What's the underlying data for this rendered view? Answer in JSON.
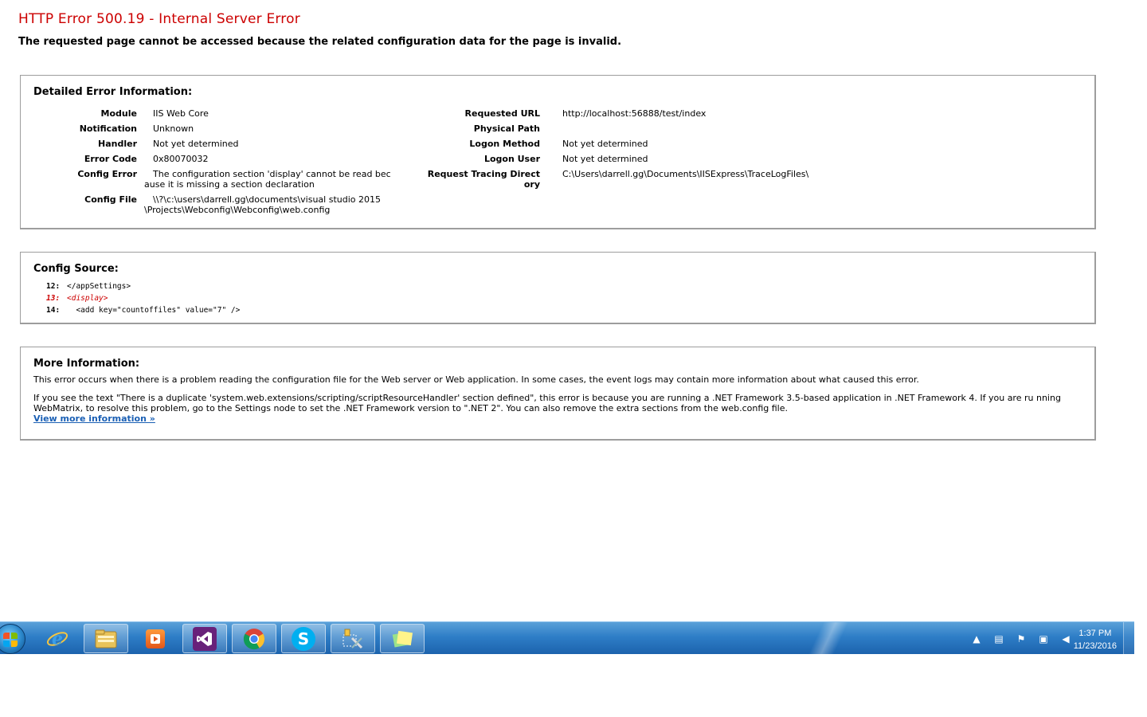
{
  "error": {
    "title": "HTTP Error 500.19 - Internal Server Error",
    "subtitle": "The requested page cannot be accessed because the related configuration data for the page is invalid."
  },
  "details": {
    "heading": "Detailed Error Information:",
    "left": [
      {
        "key": "Module",
        "value": "IIS Web Core"
      },
      {
        "key": "Notification",
        "value": "Unknown"
      },
      {
        "key": "Handler",
        "value": "Not yet determined"
      },
      {
        "key": "Error Code",
        "value": "0x80070032"
      },
      {
        "key": "Config Error",
        "value": "The configuration section 'display' cannot be read bec ause it is missing a section declaration"
      },
      {
        "key": "Config File",
        "value": "\\\\?\\c:\\users\\darrell.gg\\documents\\visual studio 2015 \\Projects\\Webconfig\\Webconfig\\web.config"
      }
    ],
    "right": [
      {
        "key": "Requested URL",
        "value": "http://localhost:56888/test/index"
      },
      {
        "key": "Physical Path",
        "value": ""
      },
      {
        "key": "Logon Method",
        "value": "Not yet determined"
      },
      {
        "key": "Logon User",
        "value": "Not yet determined"
      },
      {
        "key": "Request Tracing Direct ory",
        "value": "C:\\Users\\darrell.gg\\Documents\\IISExpress\\TraceLogFiles\\"
      }
    ]
  },
  "source": {
    "heading": "Config Source:",
    "lines": [
      {
        "num": "12:",
        "code": "</appSettings>"
      },
      {
        "num": "13:",
        "code": "<display>"
      },
      {
        "num": "14:",
        "code": "  <add key=\"countoffiles\" value=\"7\" />"
      }
    ]
  },
  "more": {
    "heading": "More Information:",
    "p1": "This error occurs when there is a problem reading the configuration file for the Web server or Web application. In some cases, the event logs may contain more information about what caused this error.",
    "p2": "If you see the text \"There is a duplicate 'system.web.extensions/scripting/scriptResourceHandler' section defined\", this error is because you are running a .NET Framework 3.5-based application in .NET Framework 4. If you are ru nning WebMatrix, to resolve this problem, go to the Settings node to set the .NET Framework version to \".NET 2\". You can also remove the extra sections from the web.config file.",
    "link": "View more information »"
  },
  "taskbar": {
    "apps": [
      "internet-explorer-icon",
      "file-explorer-icon",
      "media-player-icon",
      "visual-studio-icon",
      "chrome-icon",
      "skype-icon",
      "tools-icon",
      "sticky-notes-icon"
    ],
    "clock": {
      "time": "1:37 PM",
      "date": "11/23/2016"
    }
  }
}
